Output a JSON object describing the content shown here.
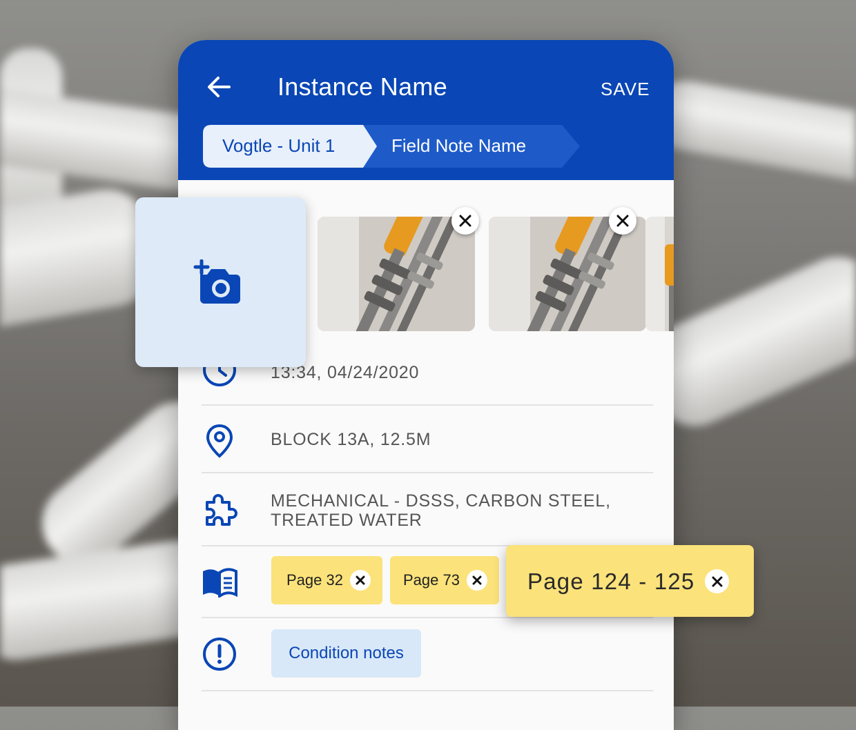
{
  "header": {
    "title": "Instance Name",
    "save_label": "SAVE",
    "breadcrumbs": [
      "Vogtle - Unit 1",
      "Field Note Name"
    ]
  },
  "details": {
    "timestamp": "13:34, 04/24/2020",
    "location": "BLOCK 13A, 12.5M",
    "system_line1": "MECHANICAL - DSSS, CARBON STEEL,",
    "system_line2": "TREATED WATER",
    "references": [
      "Page 32",
      "Page 73",
      "Page 124 - 125"
    ],
    "condition_label": "Condition notes"
  },
  "icons": {
    "back": "arrow-left-icon",
    "add_photo": "add-photo-camera-icon",
    "remove": "close-icon",
    "time": "clock-icon",
    "location": "map-pin-icon",
    "system": "puzzle-piece-icon",
    "references": "book-icon",
    "condition": "alert-circle-icon"
  },
  "colors": {
    "primary": "#0a46b5",
    "chip": "#fbe27a",
    "condition_chip": "#d8e8f8"
  }
}
